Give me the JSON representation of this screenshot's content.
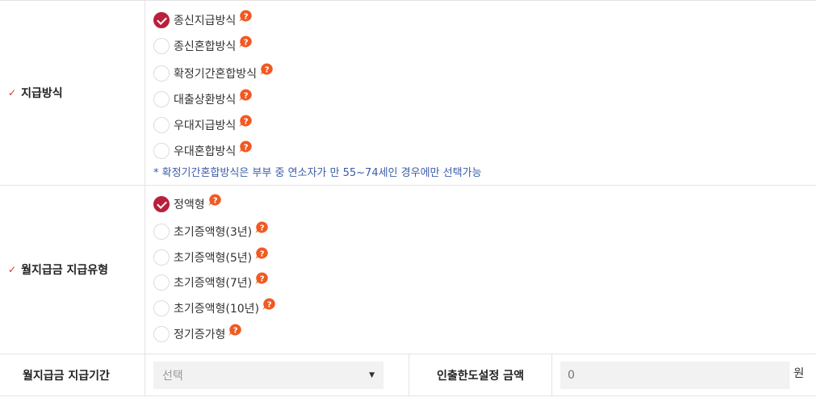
{
  "section_payment_method": {
    "label": "지급방식",
    "options": [
      {
        "label": "종신지급방식",
        "selected": true
      },
      {
        "label": "종신혼합방식",
        "selected": false
      },
      {
        "label": "확정기간혼합방식",
        "selected": false
      },
      {
        "label": "대출상환방식",
        "selected": false
      },
      {
        "label": "우대지급방식",
        "selected": false
      },
      {
        "label": "우대혼합방식",
        "selected": false
      }
    ],
    "note": "* 확정기간혼합방식은 부부 중 연소자가 만 55~74세인 경우에만 선택가능"
  },
  "section_monthly_type": {
    "label": "월지급금 지급유형",
    "options": [
      {
        "label": "정액형",
        "selected": true
      },
      {
        "label": "초기증액형(3년)",
        "selected": false
      },
      {
        "label": "초기증액형(5년)",
        "selected": false
      },
      {
        "label": "초기증액형(7년)",
        "selected": false
      },
      {
        "label": "초기증액형(10년)",
        "selected": false
      },
      {
        "label": "정기증가형",
        "selected": false
      }
    ]
  },
  "row_bottom": {
    "period_label": "월지급금 지급기간",
    "period_select_value": "선택",
    "limit_label": "인출한도설정 금액",
    "limit_placeholder": "0",
    "limit_unit": "원"
  },
  "icons": {
    "required": "check-mark-icon",
    "help": "question-bubble-icon",
    "dropdown": "caret-down-icon"
  },
  "colors": {
    "accent": "#b8203b",
    "help_icon": "#f05a22",
    "note_text": "#3b5ca8"
  }
}
